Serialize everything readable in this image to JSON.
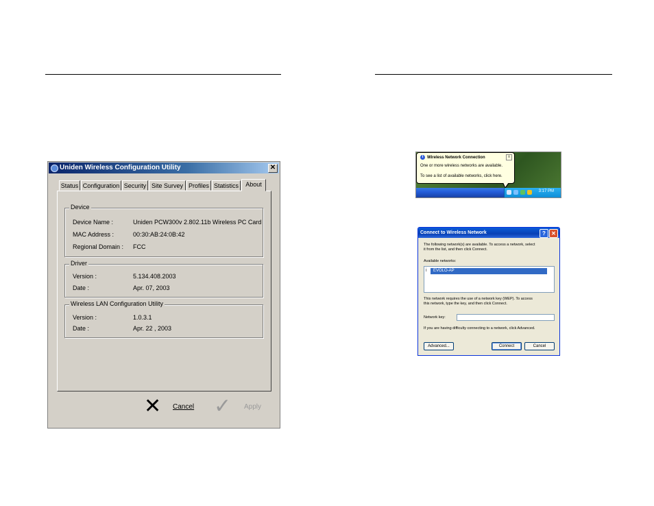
{
  "uniden": {
    "title": "Uniden Wireless Configuration Utility",
    "close_glyph": "✕",
    "tabs": [
      "Status",
      "Configuration",
      "Security",
      "Site Survey",
      "Profiles",
      "Statistics",
      "About"
    ],
    "active_tab": "About",
    "device": {
      "legend": "Device",
      "rows": [
        {
          "label": "Device Name :",
          "value": "Uniden PCW300v 2.802.11b Wireless PC Card"
        },
        {
          "label": "MAC Address :",
          "value": "00:30:AB:24:0B:42"
        },
        {
          "label": "Regional Domain :",
          "value": "FCC"
        }
      ]
    },
    "driver": {
      "legend": "Driver",
      "rows": [
        {
          "label": "Version :",
          "value": "5.134.408.2003"
        },
        {
          "label": "Date :",
          "value": "Apr. 07, 2003"
        }
      ]
    },
    "utility": {
      "legend": "Wireless LAN Configuration Utility",
      "rows": [
        {
          "label": "Version :",
          "value": "1.0.3.1"
        },
        {
          "label": "Date :",
          "value": "Apr. 22 , 2003"
        }
      ]
    },
    "cancel_label": "Cancel",
    "apply_label": "Apply",
    "cancel_glyph": "✕",
    "apply_glyph": "✓"
  },
  "balloon": {
    "info_glyph": "i",
    "title": "Wireless Network Connection",
    "line1": "One or more wireless networks are available.",
    "line2": "To see a list of available networks, click here.",
    "close_glyph": "x",
    "clock": "3:17 PM"
  },
  "connect": {
    "title": "Connect to Wireless Network",
    "help_glyph": "?",
    "close_glyph": "✕",
    "intro1": "The following network(s) are available. To access a network, select",
    "intro2": "it from the list, and then click Connect.",
    "available_label": "Available networks:",
    "network_icon": "i",
    "network": "EVOLO-AP",
    "wep1": "This network requires the use of a network key (WEP). To access",
    "wep2": "this network, type the key, and then click Connect.",
    "key_label": "Network key:",
    "key_value": "",
    "help_text": "If you are having difficulty connecting to a network, click Advanced.",
    "advanced_label": "Advanced...",
    "connect_label": "Connect",
    "cancel_label": "Cancel"
  },
  "colors": {
    "xp_blue": "#0a5bd8",
    "win_gray": "#d4d0c8",
    "selection": "#316ac5"
  }
}
